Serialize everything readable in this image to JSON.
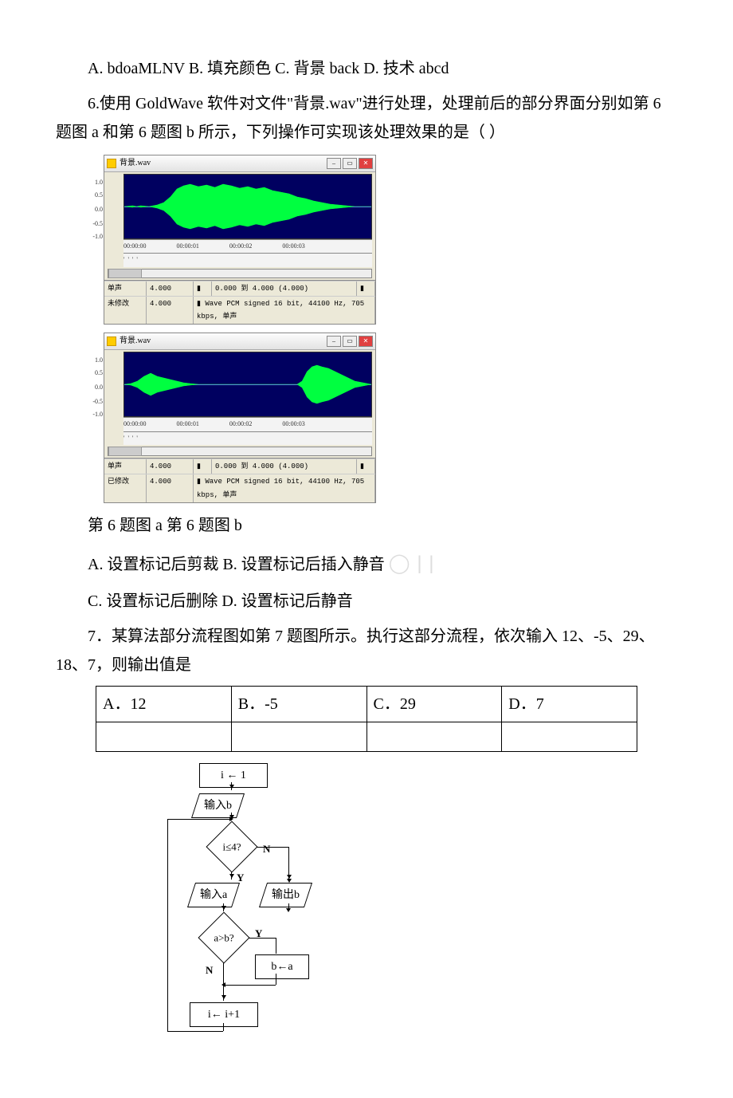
{
  "q5": {
    "options_line": "A. bdoaMLNV B. 填充颜色 C. 背景 back D. 技术 abcd"
  },
  "q6": {
    "stem": "6.使用 GoldWave 软件对文件\"背景.wav\"进行处理，处理前后的部分界面分别如第 6 题图 a 和第 6 题图 b 所示，下列操作可实现该处理效果的是（ ）",
    "fig_a_title": "背景.wav",
    "fig_b_title": "背景.wav",
    "timeline_ticks": [
      "00:00:00",
      "00:00:01",
      "00:00:02",
      "00:00:03"
    ],
    "timeline_dots": "' ' ' '",
    "ylabels": [
      "1.0",
      "0.5",
      "0.0",
      "-0.5",
      "-1.0"
    ],
    "status_a_row1": [
      "单声",
      "4.000",
      "▮",
      "0.000 到 4.000 (4.000)",
      "▮"
    ],
    "status_a_row2": [
      "未修改",
      "4.000",
      "▮ Wave PCM signed 16 bit, 44100 Hz, 705 kbps, 单声"
    ],
    "status_b_row1": [
      "单声",
      "4.000",
      "▮",
      "0.000 到 4.000 (4.000)",
      "▮"
    ],
    "status_b_row2": [
      "已修改",
      "4.000",
      "▮ Wave PCM signed 16 bit, 44100 Hz, 705 kbps, 单声"
    ],
    "caption": "第 6 题图 a 第 6 题图 b",
    "opt_line1": "A. 设置标记后剪裁 B. 设置标记后插入静音",
    "opt_line2": "C. 设置标记后删除 D. 设置标记后静音",
    "watermark_tail": "◯ | |"
  },
  "q7": {
    "stem": "7．某算法部分流程图如第 7 题图所示。执行这部分流程，依次输入 12、-5、29、18、7，则输出值是",
    "answers": [
      "A．12",
      "B．-5",
      "C．29",
      "D．7"
    ],
    "flow": {
      "n1": "i ← 1",
      "n2": "输入b",
      "n3": "i≤4?",
      "n3_yes": "Y",
      "n3_no": "N",
      "n4": "输入a",
      "n5": "输出b",
      "n6": "a>b?",
      "n6_yes": "Y",
      "n6_no": "N",
      "n7": "b←a",
      "n8": "i← i+1"
    }
  },
  "chart_data": [
    {
      "type": "waveform",
      "title": "背景.wav (before)",
      "x_ticks": [
        "00:00:00",
        "00:00:01",
        "00:00:02",
        "00:00:03"
      ],
      "x_range_seconds": [
        0,
        4
      ],
      "y_ticks": [
        1.0,
        0.5,
        0.0,
        -0.5,
        -1.0
      ],
      "y_range": [
        -1.0,
        1.0
      ],
      "channels": "mono",
      "duration_s": 4.0,
      "selection_s": [
        0.0,
        4.0
      ],
      "format": "Wave PCM signed 16 bit, 44100 Hz, 705 kbps",
      "modified": false,
      "envelope_amplitude_estimate": [
        {
          "t": 0.0,
          "amp": 0.05
        },
        {
          "t": 0.4,
          "amp": 0.05
        },
        {
          "t": 0.6,
          "amp": 0.25
        },
        {
          "t": 1.0,
          "amp": 0.55
        },
        {
          "t": 1.4,
          "amp": 0.7
        },
        {
          "t": 2.0,
          "amp": 0.65
        },
        {
          "t": 2.6,
          "amp": 0.55
        },
        {
          "t": 3.2,
          "amp": 0.35
        },
        {
          "t": 3.6,
          "amp": 0.1
        },
        {
          "t": 4.0,
          "amp": 0.05
        }
      ]
    },
    {
      "type": "waveform",
      "title": "背景.wav (after)",
      "x_ticks": [
        "00:00:00",
        "00:00:01",
        "00:00:02",
        "00:00:03"
      ],
      "x_range_seconds": [
        0,
        4
      ],
      "y_ticks": [
        1.0,
        0.5,
        0.0,
        -0.5,
        -1.0
      ],
      "y_range": [
        -1.0,
        1.0
      ],
      "channels": "mono",
      "duration_s": 4.0,
      "selection_s": [
        0.0,
        4.0
      ],
      "format": "Wave PCM signed 16 bit, 44100 Hz, 705 kbps",
      "modified": true,
      "envelope_amplitude_estimate": [
        {
          "t": 0.0,
          "amp": 0.05
        },
        {
          "t": 0.4,
          "amp": 0.25
        },
        {
          "t": 0.8,
          "amp": 0.2
        },
        {
          "t": 1.2,
          "amp": 0.02
        },
        {
          "t": 2.0,
          "amp": 0.02
        },
        {
          "t": 2.6,
          "amp": 0.02
        },
        {
          "t": 2.9,
          "amp": 0.55
        },
        {
          "t": 3.2,
          "amp": 0.6
        },
        {
          "t": 3.6,
          "amp": 0.35
        },
        {
          "t": 4.0,
          "amp": 0.1
        }
      ]
    }
  ]
}
